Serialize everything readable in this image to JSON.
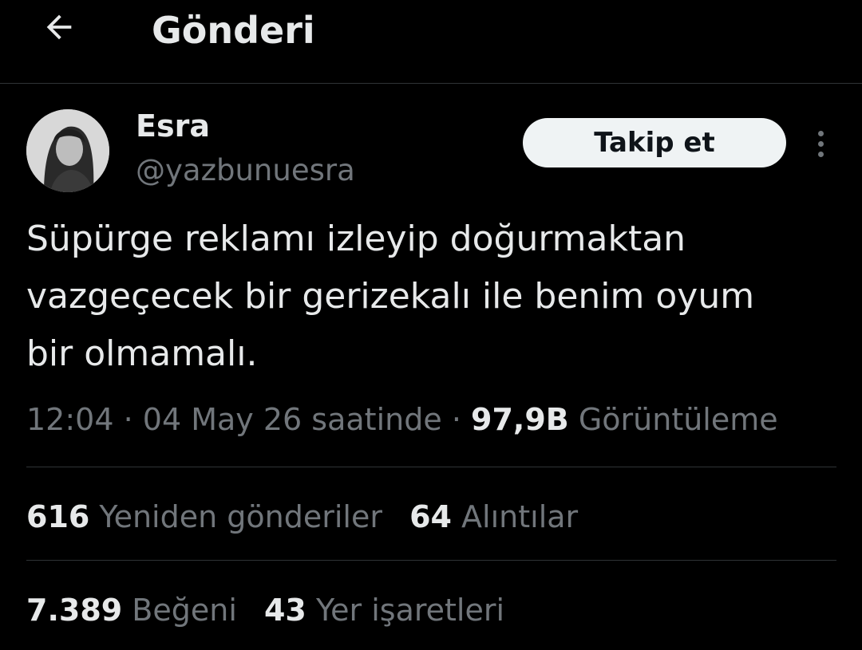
{
  "header": {
    "back_icon": "arrow-left-icon",
    "title": "Gönderi"
  },
  "author": {
    "display_name": "Esra",
    "handle": "@yazbunuesra",
    "avatar_icon": "avatar-photo"
  },
  "actions": {
    "follow_label": "Takip et",
    "more_icon": "more-vertical-icon"
  },
  "tweet": {
    "text": "Süpürge reklamı izleyip doğurmaktan\nvazgeçecek bir gerizekalı ile benim oyum\nbir olmamalı."
  },
  "meta": {
    "time": "12:04",
    "separator": "·",
    "date": "04 May 26 saatinde",
    "views_count": "97,9B",
    "views_label": "Görüntüleme"
  },
  "stats": {
    "reposts_count": "616",
    "reposts_label": "Yeniden gönderiler",
    "quotes_count": "64",
    "quotes_label": "Alıntılar",
    "likes_count": "7.389",
    "likes_label": "Beğeni",
    "bookmarks_count": "43",
    "bookmarks_label": "Yer işaretleri"
  },
  "colors": {
    "background": "#000000",
    "primary_text": "#e7e9ea",
    "secondary_text": "#71767b",
    "divider": "#2f3336",
    "follow_button_bg": "#eff3f4"
  }
}
